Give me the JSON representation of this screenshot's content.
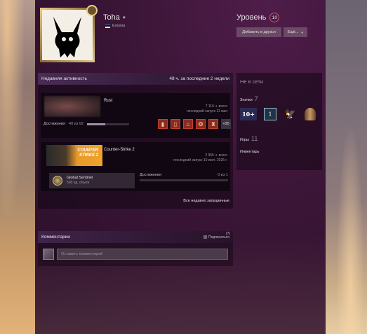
{
  "profile": {
    "name": "Toha",
    "country": "Estonia",
    "level_label": "Уровень",
    "level": "10",
    "add_friend": "Добавить в друзья",
    "more": "Ещё..."
  },
  "activity": {
    "title": "Недавняя активность",
    "hours": "48 ч. за последние 2 недели",
    "games": [
      {
        "name": "Rust",
        "total": "7 116 ч. всего",
        "last": "последний запуск 11 мая",
        "ach_label": "Достижения",
        "ach_count": "40 из 92",
        "ach_progress": 0.435,
        "ach_more": "+35"
      },
      {
        "name": "Counter-Strike 2",
        "total": "2 955 ч. всего",
        "last": "последний запуск 10 июл. 2025 г.",
        "capsule_line1": "COUNTER",
        "capsule_line2": "STRIKE 2",
        "badge_name": "Global Sentinel",
        "badge_xp": "500 ед. опыта",
        "ach_label": "Достижения",
        "ach_count": "0 из 1"
      }
    ],
    "recent_link": "Все недавно запущенные"
  },
  "sidebar": {
    "status": "Не в сети",
    "badges_label": "Значки",
    "badges_count": "7",
    "badges": [
      "10+",
      "1"
    ],
    "games_label": "Игры",
    "games_count": "11",
    "inventory": "Инвентарь"
  },
  "comments": {
    "title": "Комментарии",
    "subscribe": "Подписаться",
    "help": "(?)",
    "placeholder": "Оставить комментарий"
  },
  "colors": {
    "accent_level": "#d9524f",
    "achievement_red": "#8d2b1f",
    "flag": [
      "#2a6bc4",
      "#111111",
      "#f2f2f2"
    ]
  }
}
